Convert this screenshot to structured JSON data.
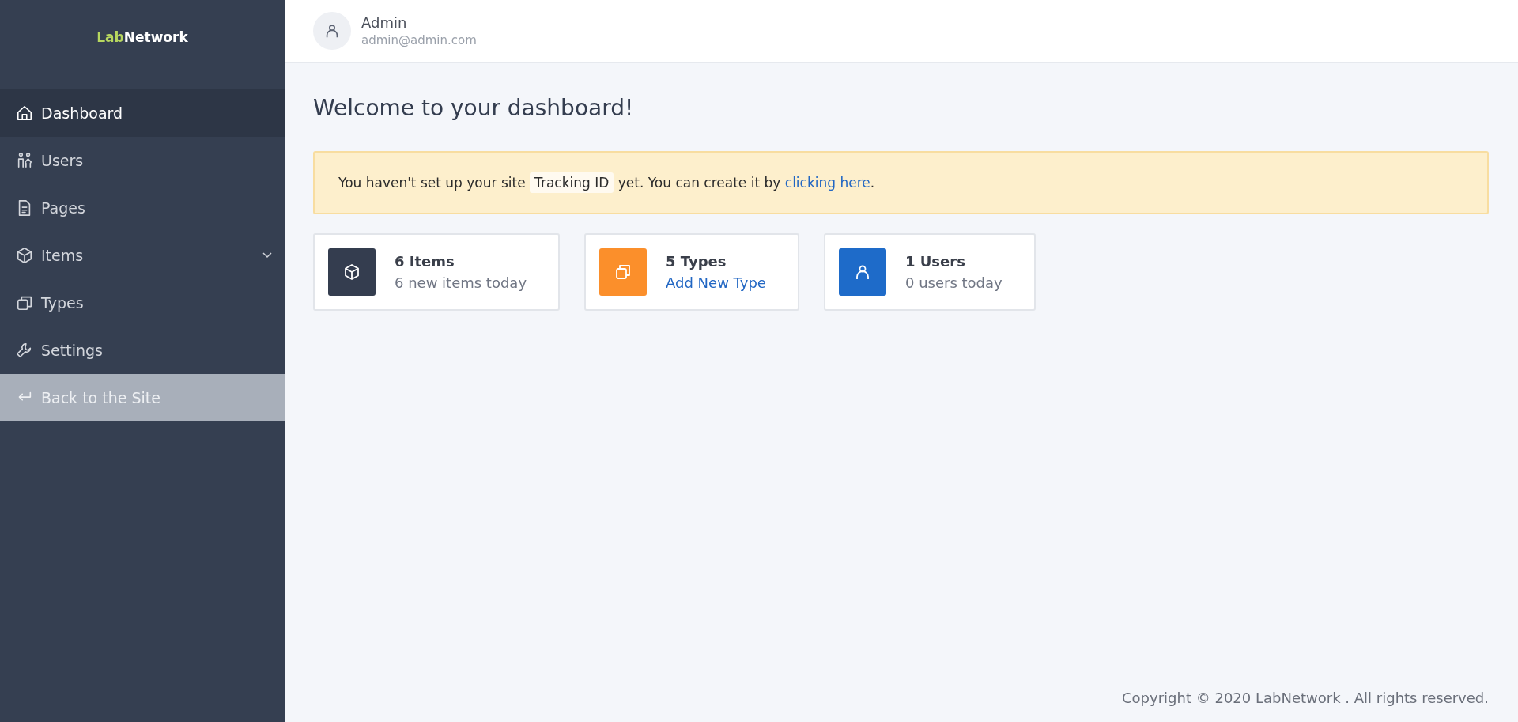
{
  "brand": {
    "accent": "Lab",
    "rest": "Network"
  },
  "sidebar": {
    "items": [
      {
        "label": "Dashboard",
        "selected": true,
        "kind": "page"
      },
      {
        "label": "Users",
        "selected": false,
        "kind": "page"
      },
      {
        "label": "Pages",
        "selected": false,
        "kind": "page"
      },
      {
        "label": "Items",
        "selected": false,
        "kind": "group"
      },
      {
        "label": "Types",
        "selected": false,
        "kind": "page"
      },
      {
        "label": "Settings",
        "selected": false,
        "kind": "page"
      },
      {
        "label": "Back to the Site",
        "selected": false,
        "kind": "exit"
      }
    ]
  },
  "header": {
    "name": "Admin",
    "email": "admin@admin.com"
  },
  "title": "Welcome to your dashboard!",
  "alert": {
    "before": "You haven't set up your site",
    "code": "Tracking ID",
    "after": "yet. You can create it by",
    "link": "clicking here",
    "end": "."
  },
  "cards": [
    {
      "title": "6 Items",
      "subtitle": "6 new items today",
      "kind": "text",
      "color": "#343d4f"
    },
    {
      "title": "5 Types",
      "subtitle": "Add New Type",
      "kind": "link",
      "color": "#fb8f2b"
    },
    {
      "title": "1 Users",
      "subtitle": "0 users today",
      "kind": "text",
      "color": "#1e6bc9"
    }
  ],
  "footer": "Copyright © 2020 LabNetwork . All rights reserved."
}
